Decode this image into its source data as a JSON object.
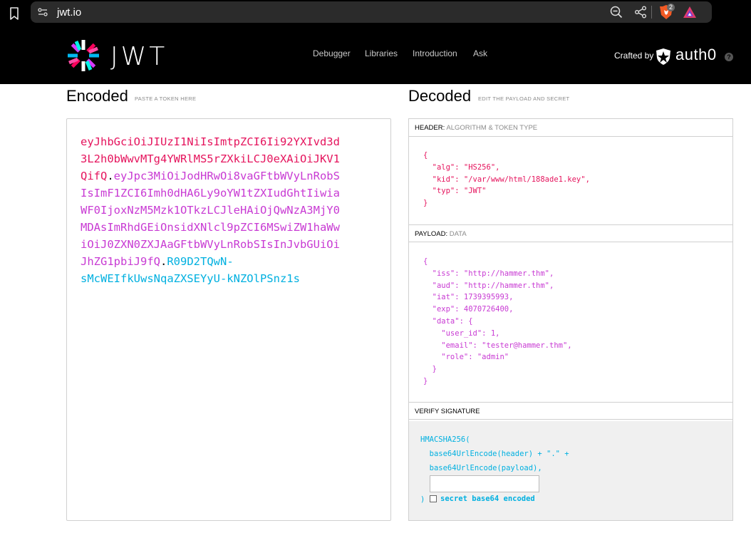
{
  "browser": {
    "url": "jwt.io",
    "brave_badge_count": "2"
  },
  "header": {
    "logo_text": "JWT",
    "nav": [
      "Debugger",
      "Libraries",
      "Introduction",
      "Ask"
    ],
    "crafted_by": "Crafted by",
    "brand": "auth0",
    "help": "?"
  },
  "encoded": {
    "title": "Encoded",
    "subtitle": "PASTE A TOKEN HERE",
    "token": {
      "header_part": "eyJhbGciOiJIUzI1NiIsImtpZCI6Ii92YXIvd3d3L2h0bWwvMTg4YWRlMS5rZXkiLCJ0eXAiOiJKV1QifQ",
      "payload_part": "eyJpc3MiOiJodHRwOi8vaGFtbWVyLnRobSIsImF1ZCI6Imh0dHA6Ly9oYW1tZXIudGhtIiwiaWF0IjoxNzM5Mzk1OTkzLCJleHAiOjQwNzA3MjY0MDAsImRhdGEiOnsidXNlcl9pZCI6MSwiZW1haWwiOiJ0ZXN0ZXJAaGFtbWVyLnRobSIsInJvbGUiOiJhZG1pbiJ9fQ",
      "signature_part": "R09D2TQwN-sMcWEIfkUwsNqaZXSEYyU-kNZOlPSnz1s",
      "lines": [
        [
          {
            "t": "eyJhbGciOiJIUzI1NiIsImtpZCI6Ii92YXIvd3d",
            "c": "h"
          }
        ],
        [
          {
            "t": "3L2h0bWwvMTg4YWRlMS5rZXkiLCJ0eXAiOiJKV1",
            "c": "h"
          }
        ],
        [
          {
            "t": "QifQ",
            "c": "h"
          },
          {
            "t": ".",
            "c": "d"
          },
          {
            "t": "eyJpc3MiOiJodHRwOi8vaGFtbWVyLnRobS",
            "c": "p"
          }
        ],
        [
          {
            "t": "IsImF1ZCI6Imh0dHA6Ly9oYW1tZXIudGhtIiwia",
            "c": "p"
          }
        ],
        [
          {
            "t": "WF0IjoxNzM5Mzk1OTkzLCJleHAiOjQwNzA3MjY0",
            "c": "p"
          }
        ],
        [
          {
            "t": "MDAsImRhdGEiOnsidXNlcl9pZCI6MSwiZW1haWw",
            "c": "p"
          }
        ],
        [
          {
            "t": "iOiJ0ZXN0ZXJAaGFtbWVyLnRobSIsInJvbGUiOi",
            "c": "p"
          }
        ],
        [
          {
            "t": "JhZG1pbiJ9fQ",
            "c": "p"
          },
          {
            "t": ".",
            "c": "d"
          },
          {
            "t": "R09D2TQwN-",
            "c": "s"
          }
        ],
        [
          {
            "t": "sMcWEIfkUwsNqaZXSEYyU-kNZOlPSnz1s",
            "c": "s"
          }
        ]
      ]
    }
  },
  "decoded": {
    "title": "Decoded",
    "subtitle": "EDIT THE PAYLOAD AND SECRET",
    "header_section": {
      "label": "HEADER:",
      "sub": "ALGORITHM & TOKEN TYPE",
      "lines": [
        "{",
        "  \"alg\": \"HS256\",",
        "  \"kid\": \"/var/www/html/188ade1.key\",",
        "  \"typ\": \"JWT\"",
        "}"
      ]
    },
    "payload_section": {
      "label": "PAYLOAD:",
      "sub": "DATA",
      "lines": [
        "{",
        "  \"iss\": \"http://hammer.thm\",",
        "  \"aud\": \"http://hammer.thm\",",
        "  \"iat\": 1739395993,",
        "  \"exp\": 4070726400,",
        "  \"data\": {",
        "    \"user_id\": 1,",
        "    \"email\": \"tester@hammer.thm\",",
        "    \"role\": \"admin\"",
        "  }",
        "}"
      ]
    },
    "verify_section": {
      "label": "VERIFY SIGNATURE",
      "line1": "HMACSHA256(",
      "line2": "  base64UrlEncode(header) + \".\" +",
      "line3": "  base64UrlEncode(payload),",
      "close": ")",
      "secret_value": "",
      "b64_label": "secret base64 encoded",
      "b64_checked": false
    }
  }
}
